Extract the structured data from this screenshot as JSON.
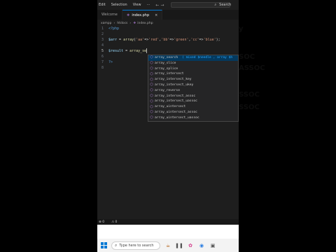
{
  "menu": {
    "items": [
      "Edit",
      "Selection",
      "View",
      "···"
    ],
    "search_label": "Search"
  },
  "tabs": [
    {
      "label": "Welcome",
      "active": false
    },
    {
      "label": "index.php",
      "active": true
    }
  ],
  "breadcrumb": [
    "xampp",
    "htdocs",
    "index.php"
  ],
  "editor": {
    "lines": [
      {
        "n": "1",
        "tokens": [
          {
            "t": "<?php",
            "c": "kw"
          }
        ]
      },
      {
        "n": "2",
        "tokens": []
      },
      {
        "n": "3",
        "tokens": [
          {
            "t": "$arr",
            "c": "var"
          },
          {
            "t": " = ",
            "c": ""
          },
          {
            "t": "array",
            "c": "fn"
          },
          {
            "t": "(",
            "c": ""
          },
          {
            "t": "'aa'",
            "c": "str"
          },
          {
            "t": "=>",
            "c": ""
          },
          {
            "t": "'red'",
            "c": "str"
          },
          {
            "t": ",",
            "c": ""
          },
          {
            "t": "'bb'",
            "c": "str"
          },
          {
            "t": "=>",
            "c": ""
          },
          {
            "t": "'green'",
            "c": "str"
          },
          {
            "t": ",",
            "c": ""
          },
          {
            "t": "'cc'",
            "c": "str"
          },
          {
            "t": "=>",
            "c": ""
          },
          {
            "t": "'blue'",
            "c": "str"
          },
          {
            "t": ");",
            "c": ""
          }
        ]
      },
      {
        "n": "4",
        "tokens": []
      },
      {
        "n": "5",
        "tokens": [
          {
            "t": "$result",
            "c": "var"
          },
          {
            "t": " = ",
            "c": ""
          },
          {
            "t": "array_se",
            "c": "fn"
          }
        ],
        "current": true
      },
      {
        "n": "6",
        "tokens": []
      },
      {
        "n": "7",
        "tokens": [
          {
            "t": "?>",
            "c": "kw"
          }
        ]
      },
      {
        "n": "8",
        "tokens": []
      }
    ]
  },
  "autocomplete": {
    "selected_detail": "( mixed $needle , array $h",
    "items": [
      {
        "label": "array_search",
        "selected": true
      },
      {
        "label": "array_slice"
      },
      {
        "label": "array_splice"
      },
      {
        "label": "array_intersect"
      },
      {
        "label": "array_intersect_key"
      },
      {
        "label": "array_intersect_ukey"
      },
      {
        "label": "array_reverse"
      },
      {
        "label": "array_intersect_assoc"
      },
      {
        "label": "array_intersect_uassoc"
      },
      {
        "label": "array_uintersect"
      },
      {
        "label": "array_uintersect_assoc"
      },
      {
        "label": "array_uintersect_uassoc"
      }
    ]
  },
  "statusbar": {
    "errors": "0",
    "warnings": "0"
  },
  "taskbar": {
    "search_placeholder": "Type here to search"
  },
  "background_text": [
    "y",
    "",
    "SOC",
    "ASSOC",
    "",
    "SSOC",
    "SSOC"
  ],
  "colors": {
    "accent": "#0078d4",
    "editor_bg": "#1e1e1e",
    "suggest_selected": "#04395e"
  }
}
